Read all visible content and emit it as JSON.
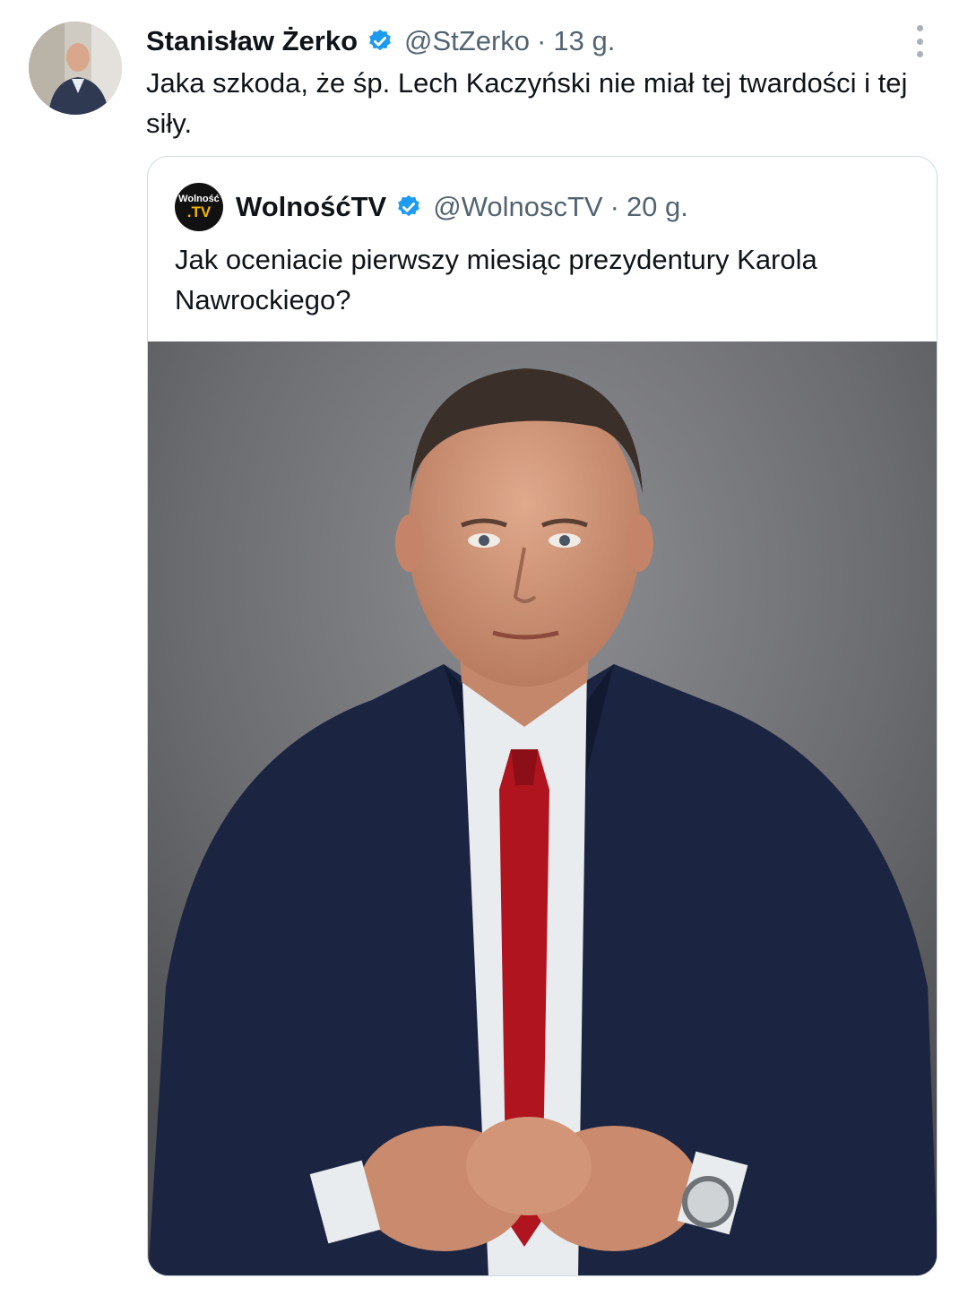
{
  "tweet": {
    "author_name": "Stanisław Żerko",
    "author_handle": "@StZerko",
    "separator": "·",
    "time": "13 g.",
    "text": "Jaka szkoda, że śp. Lech Kaczyński nie miał tej twardości i tej siły.",
    "icons": {
      "verified": "verified-badge-icon",
      "more": "more-options-icon"
    }
  },
  "quote": {
    "author_name": "WolnośćTV",
    "author_handle": "@WolnoscTV",
    "separator": "·",
    "time": "20 g.",
    "avatar_line1": "Wolność",
    "avatar_line2": ".TV",
    "text": "Jak oceniacie pierwszy miesiąc prezydentury Karola Nawrockiego?"
  },
  "colors": {
    "verified": "#1d9bf0",
    "secondary_text": "#536471",
    "border": "#cfd9de"
  }
}
